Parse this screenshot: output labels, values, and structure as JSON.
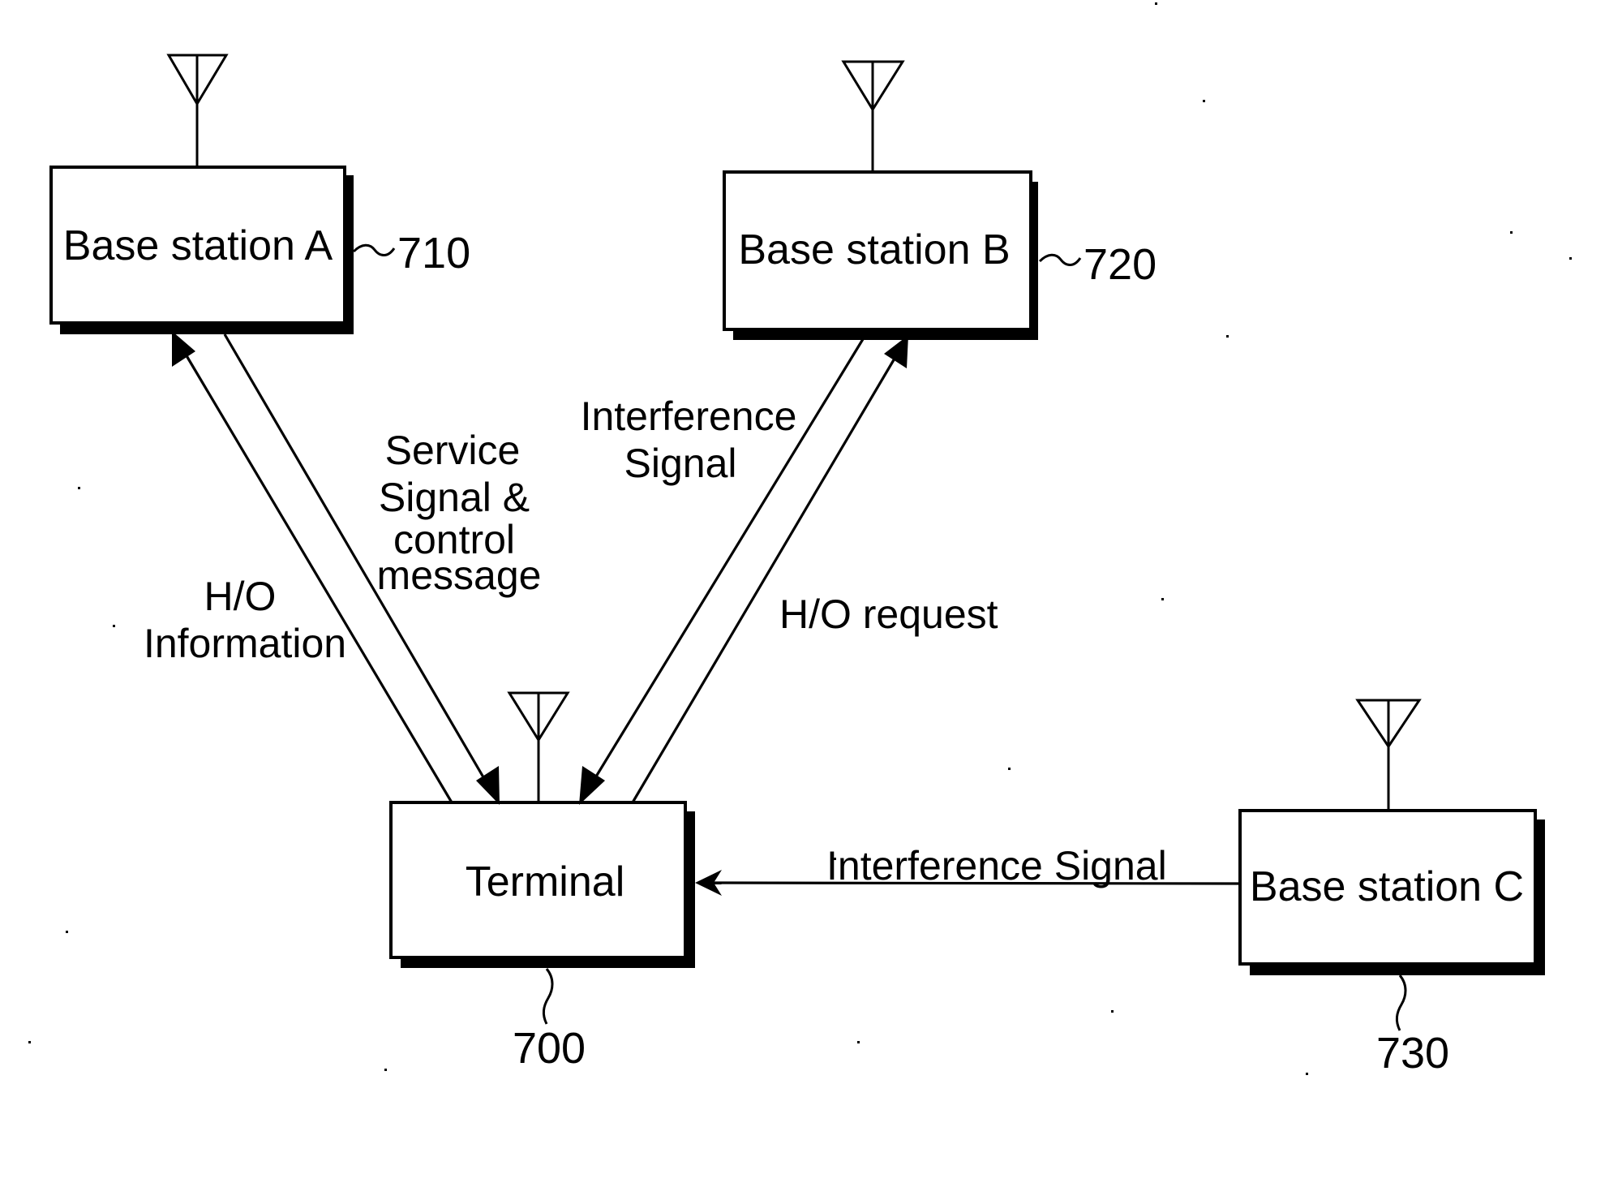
{
  "figure": {
    "type": "block diagram",
    "background": "#ffffff",
    "ink_color": "#000000"
  },
  "nodes": {
    "base_station_a": {
      "label": "Base station A",
      "ref": "710",
      "has_antenna": true
    },
    "base_station_b": {
      "label": "Base station B",
      "ref": "720",
      "has_antenna": true
    },
    "terminal": {
      "label": "Terminal",
      "ref": "700",
      "has_antenna": true
    },
    "base_station_c": {
      "label": "Base station C",
      "ref": "730",
      "has_antenna": true
    }
  },
  "edges": [
    {
      "id": "ho-information",
      "from": "terminal",
      "to": "base_station_a",
      "label_lines": [
        "H/O",
        "Information"
      ]
    },
    {
      "id": "service-signal",
      "from": "base_station_a",
      "to": "terminal",
      "label_lines": [
        "Service",
        "Signal &",
        "control",
        "message"
      ]
    },
    {
      "id": "interference-b",
      "from": "base_station_b",
      "to": "terminal",
      "label_lines": [
        "Interference",
        "Signal"
      ]
    },
    {
      "id": "ho-request",
      "from": "terminal",
      "to": "base_station_b",
      "label_lines": [
        "H/O request"
      ]
    },
    {
      "id": "interference-c",
      "from": "base_station_c",
      "to": "terminal",
      "label_lines": [
        "Interference Signal"
      ]
    }
  ],
  "icons": {
    "antenna": "antenna-icon",
    "arrowhead": "arrowhead-icon",
    "leader": "reference-leader-line"
  }
}
